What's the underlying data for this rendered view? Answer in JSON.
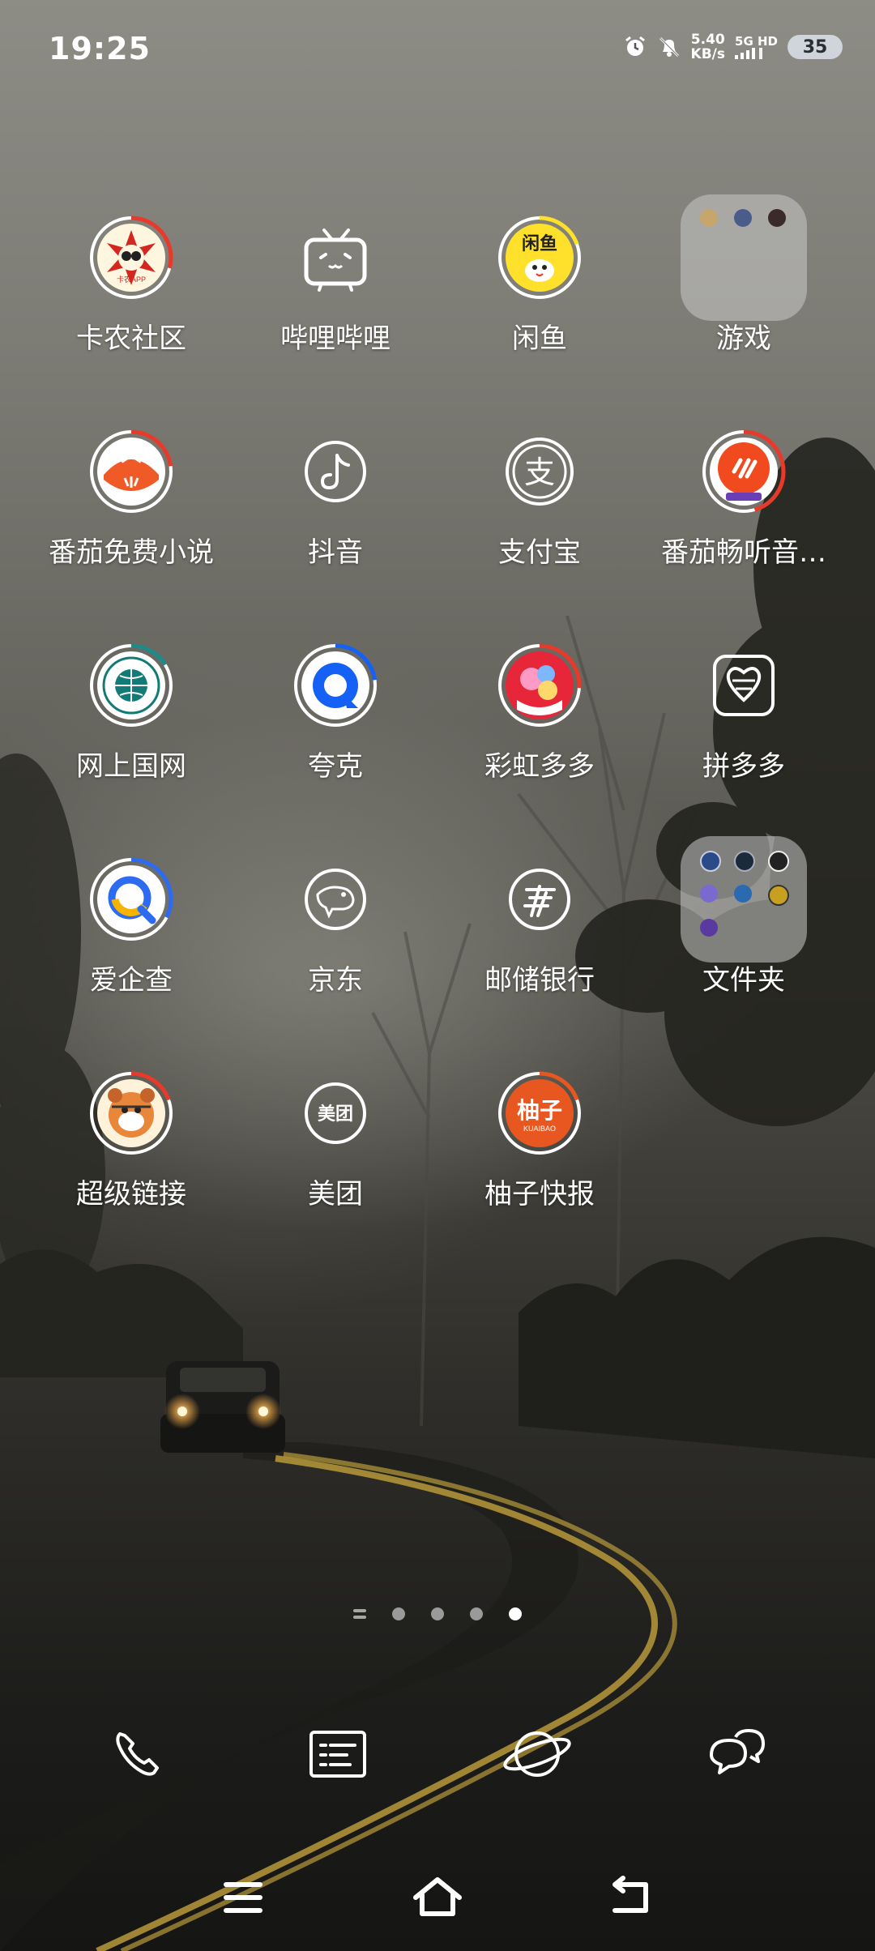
{
  "status_bar": {
    "time": "19:25",
    "speed_value": "5.40",
    "speed_unit": "KB/s",
    "network_top": "5G HD",
    "battery": "35",
    "icons": [
      "alarm-icon",
      "bell-off-icon",
      "signal-icon"
    ]
  },
  "apps": [
    {
      "label": "卡农社区",
      "icon": "kanong-icon",
      "badge_text": "卡农APP"
    },
    {
      "label": "哔哩哔哩",
      "icon": "bilibili-icon"
    },
    {
      "label": "闲鱼",
      "icon": "xianyu-icon",
      "badge_text": "闲鱼"
    },
    {
      "label": "游戏",
      "icon": "folder-icon",
      "is_folder": true
    },
    {
      "label": "番茄免费小说",
      "icon": "fanqie-novel-icon"
    },
    {
      "label": "抖音",
      "icon": "douyin-icon"
    },
    {
      "label": "支付宝",
      "icon": "alipay-icon",
      "badge_text": "支"
    },
    {
      "label": "番茄畅听音…",
      "icon": "fanqie-listen-icon"
    },
    {
      "label": "网上国网",
      "icon": "state-grid-icon"
    },
    {
      "label": "夸克",
      "icon": "quark-icon"
    },
    {
      "label": "彩虹多多",
      "icon": "rainbow-duoduo-icon"
    },
    {
      "label": "拼多多",
      "icon": "pinduoduo-icon"
    },
    {
      "label": "爱企查",
      "icon": "aiqicha-icon"
    },
    {
      "label": "京东",
      "icon": "jd-icon"
    },
    {
      "label": "邮储银行",
      "icon": "psbc-icon"
    },
    {
      "label": "文件夹",
      "icon": "folder-icon",
      "is_folder": true
    },
    {
      "label": "超级链接",
      "icon": "super-link-icon"
    },
    {
      "label": "美团",
      "icon": "meituan-icon",
      "badge_text": "美团"
    },
    {
      "label": "柚子快报",
      "icon": "youzi-icon",
      "badge_text": "柚子",
      "badge_sub": "KUAIBAO"
    }
  ],
  "page_indicator": {
    "pages": 4,
    "active": 4
  },
  "dock": [
    "phone-icon",
    "notes-icon",
    "browser-icon",
    "messages-icon"
  ],
  "nav": [
    "menu-icon",
    "home-icon",
    "back-icon"
  ],
  "colors": {
    "accent_red": "#e83a2b",
    "quark_blue": "#1561f5",
    "battery_bg": "#dde2eb"
  }
}
